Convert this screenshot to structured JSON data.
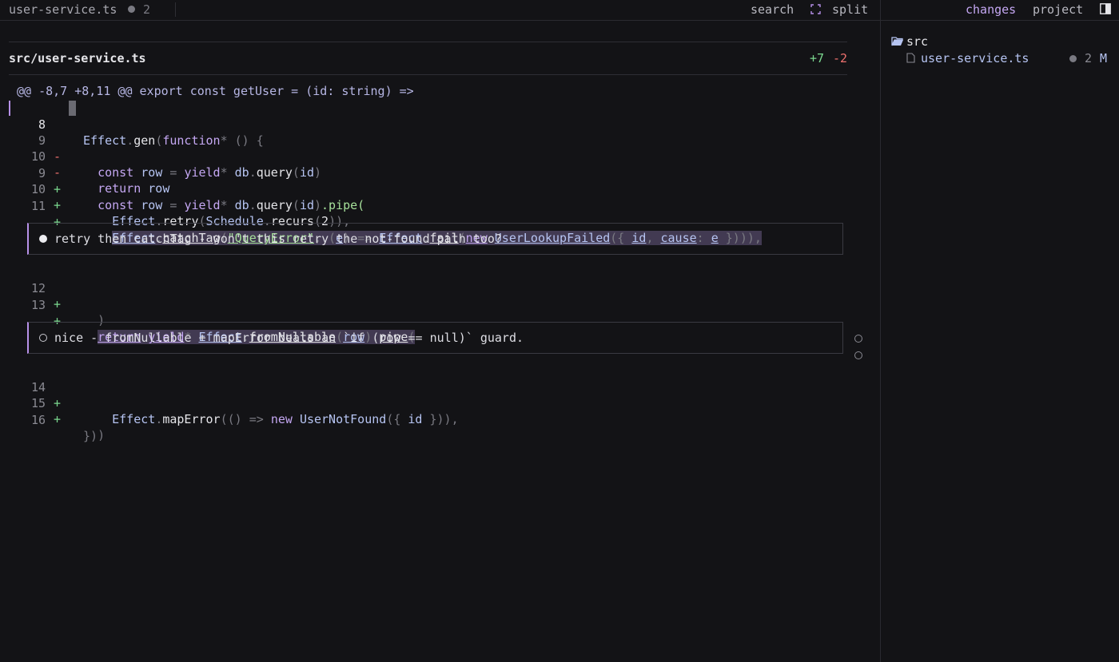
{
  "topbar": {
    "tab_title": "user-service.ts",
    "tab_count": "2",
    "search_label": "search",
    "split_label": "split",
    "changes_label": "changes",
    "project_label": "project"
  },
  "file": {
    "path": "src/user-service.ts",
    "additions": "+7",
    "deletions": "-2"
  },
  "diff": {
    "hunk_header": "@@ -8,7 +8,11 @@ export const getUser = (id: string) =>",
    "lines": [
      {
        "num": "8",
        "sign": " ",
        "text": "Effect.gen(function* () {"
      },
      {
        "num": "9",
        "sign": "-",
        "text": "  const row = yield* db.query(id)"
      },
      {
        "num": "10",
        "sign": "-",
        "text": "  return row"
      },
      {
        "num": "9",
        "sign": "+",
        "text": "  const row = yield* db.query(id).pipe("
      },
      {
        "num": "10",
        "sign": "+",
        "text": "    Effect.retry(Schedule.recurs(2)),"
      },
      {
        "num": "11",
        "sign": "+",
        "text": "    Effect.catchTag(\"QueryError\", (e) => Effect.fail(new UserLookupFailed({ id, cause: e }))),"
      },
      {
        "num": "12",
        "sign": "+",
        "text": "  )"
      },
      {
        "num": "13",
        "sign": "+",
        "text": "  return yield* Effect.fromNullable(row).pipe("
      },
      {
        "num": "14",
        "sign": "+",
        "text": "    Effect.mapError(() => new UserNotFound({ id })),"
      },
      {
        "num": "15",
        "sign": "+",
        "text": "  )"
      },
      {
        "num": "16",
        "sign": " ",
        "text": "})"
      }
    ]
  },
  "comments": [
    {
      "text": "retry then catchTag - won't this retry the not-found path too?",
      "resolved": false
    },
    {
      "text": "nice - fromNullable + mapError beats an `if (row == null)` guard.",
      "resolved": true
    }
  ],
  "sidebar": {
    "folder": "src",
    "file_name": "user-service.ts",
    "file_count": "2",
    "file_status": "M"
  },
  "colors": {
    "accent": "#b690e8",
    "added": "#7bd88f",
    "removed": "#f0716f",
    "background": "#131316"
  }
}
